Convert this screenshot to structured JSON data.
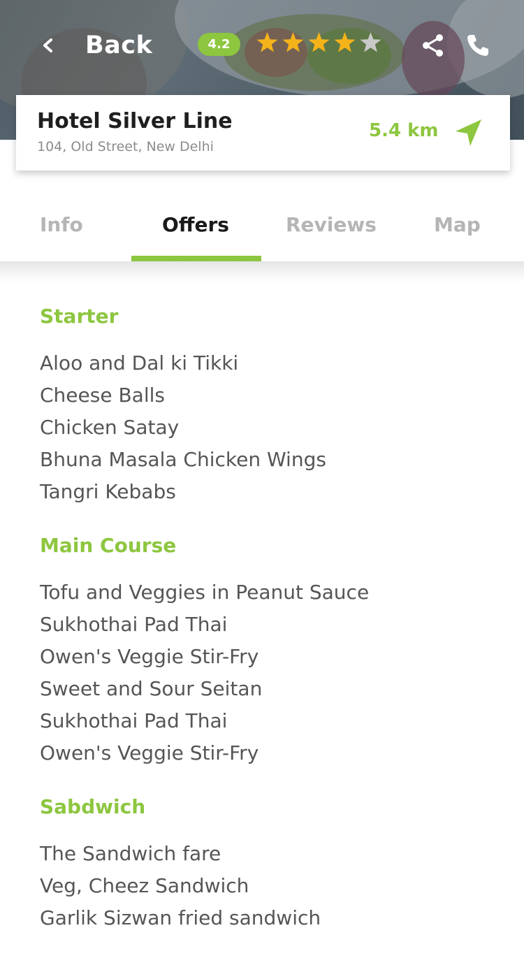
{
  "theme": {
    "accent": "#8dc63f",
    "star_filled": "#f5b31a",
    "star_empty": "#c9c9c9",
    "text_primary": "#1f1f1f",
    "text_muted": "#8c8c8c"
  },
  "header": {
    "back_label": "Back",
    "rating": "4.2",
    "stars": [
      {
        "icon": "star-filled"
      },
      {
        "icon": "star-filled"
      },
      {
        "icon": "star-filled"
      },
      {
        "icon": "star-filled"
      },
      {
        "icon": "star-empty"
      }
    ],
    "share_icon": "share-icon",
    "call_icon": "phone-icon"
  },
  "hotel": {
    "name": "Hotel Silver Line",
    "address": "104, Old Street, New Delhi",
    "distance": "5.4 km",
    "navigate_icon": "navigation-arrow-icon"
  },
  "tabs": [
    {
      "label": "Info",
      "active": false
    },
    {
      "label": "Offers",
      "active": true
    },
    {
      "label": "Reviews",
      "active": false
    },
    {
      "label": "Map",
      "active": false
    }
  ],
  "menu": {
    "sections": [
      {
        "title": "Starter",
        "items": [
          "Aloo and Dal ki Tikki",
          "Cheese Balls",
          "Chicken Satay",
          "Bhuna Masala Chicken Wings",
          "Tangri Kebabs"
        ]
      },
      {
        "title": "Main Course",
        "items": [
          "Tofu and Veggies in Peanut Sauce",
          "Sukhothai Pad Thai",
          "Owen's Veggie Stir-Fry",
          "Sweet and Sour Seitan",
          "Sukhothai Pad Thai",
          "Owen's Veggie Stir-Fry"
        ]
      },
      {
        "title": "Sabdwich",
        "items": [
          "The Sandwich fare",
          "Veg, Cheez Sandwich",
          "Garlik Sizwan fried sandwich"
        ]
      }
    ]
  }
}
